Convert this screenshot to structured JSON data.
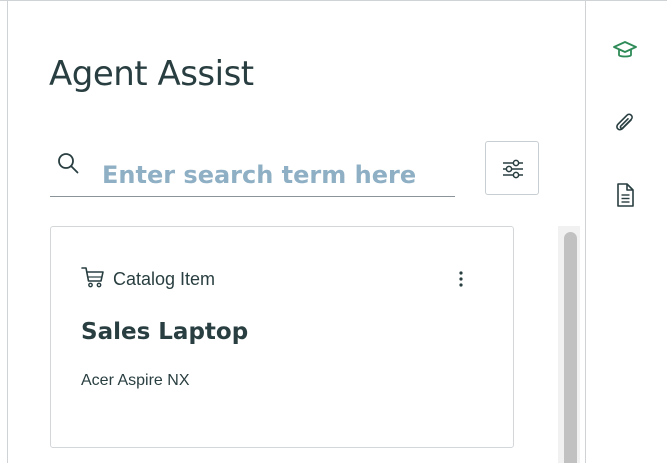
{
  "panel": {
    "title": "Agent Assist"
  },
  "search": {
    "placeholder": "Enter search term here",
    "value": ""
  },
  "filter": {
    "icon": "sliders-icon"
  },
  "results": [
    {
      "type_icon": "cart-icon",
      "type_label": "Catalog Item",
      "title": "Sales Laptop",
      "description": "Acer Aspire NX",
      "menu_icon": "kebab-menu-icon"
    }
  ],
  "rail": {
    "icons": [
      "graduation-cap-icon",
      "paperclip-icon",
      "document-icon"
    ],
    "active_color": "#2e8b57"
  },
  "colors": {
    "text": "#293e40",
    "placeholder": "#8eafc4",
    "border": "#cfd3d6"
  }
}
